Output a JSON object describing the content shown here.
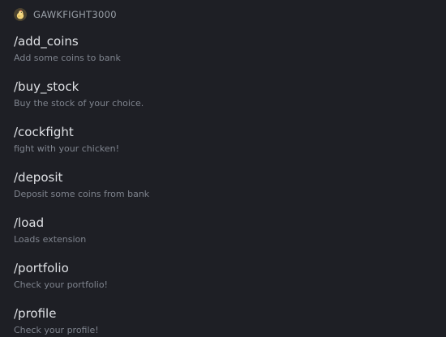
{
  "app": {
    "name": "GAWKFIGHT3000",
    "icon": "chicken-avatar-icon"
  },
  "commands": [
    {
      "name": "/add_coins",
      "description": "Add some coins to bank"
    },
    {
      "name": "/buy_stock",
      "description": "Buy the stock of your choice."
    },
    {
      "name": "/cockfight",
      "description": "fight with your chicken!"
    },
    {
      "name": "/deposit",
      "description": "Deposit some coins from bank"
    },
    {
      "name": "/load",
      "description": "Loads extension"
    },
    {
      "name": "/portfolio",
      "description": "Check your portfolio!"
    },
    {
      "name": "/profile",
      "description": "Check your profile!"
    }
  ],
  "colors": {
    "background": "#1e1f25",
    "command_text": "#dfe1e5",
    "description_text": "#7f848e",
    "header_text": "#9aa0a8"
  }
}
